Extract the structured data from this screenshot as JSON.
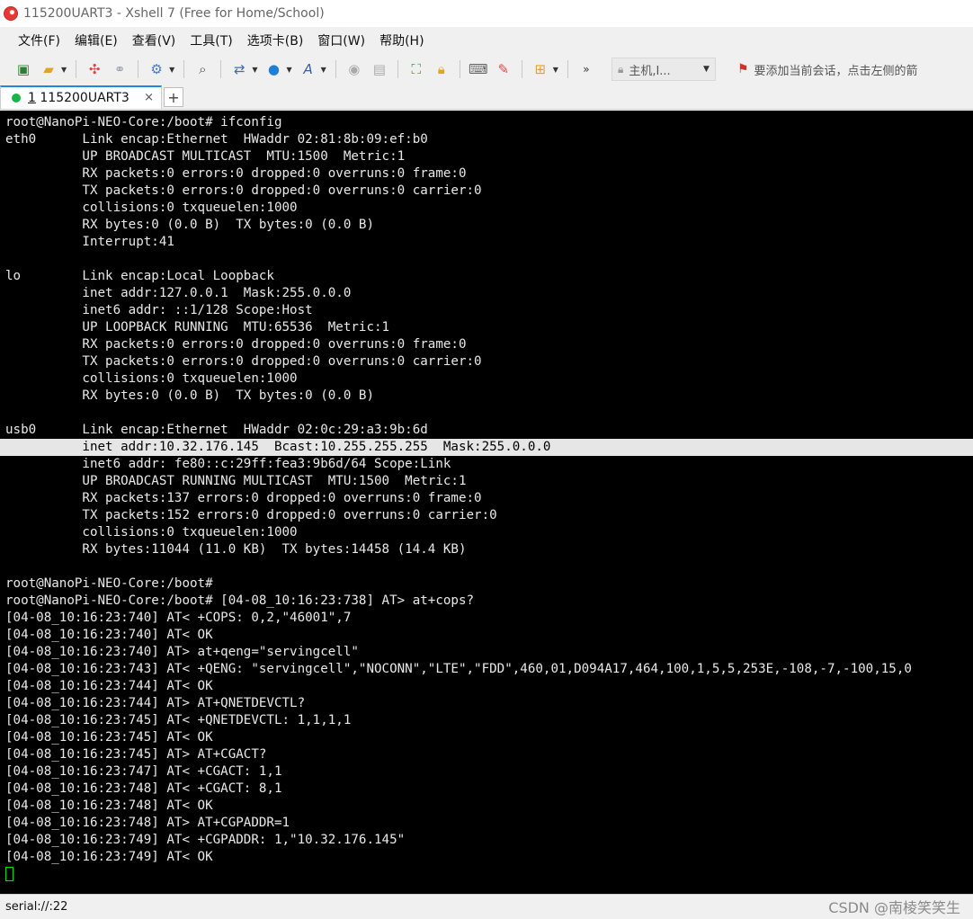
{
  "window": {
    "title": "115200UART3 - Xshell 7 (Free for Home/School)"
  },
  "menu": [
    "文件(F)",
    "编辑(E)",
    "查看(V)",
    "工具(T)",
    "选项卡(B)",
    "窗口(W)",
    "帮助(H)"
  ],
  "toolbar": {
    "host_label": "主机,I...",
    "hint": "要添加当前会话，点击左侧的箭"
  },
  "tab": {
    "number": "1",
    "label": "115200UART3",
    "close": "×",
    "add": "+"
  },
  "terminal": {
    "lines": [
      "root@NanoPi-NEO-Core:/boot# ifconfig",
      "eth0      Link encap:Ethernet  HWaddr 02:81:8b:09:ef:b0",
      "          UP BROADCAST MULTICAST  MTU:1500  Metric:1",
      "          RX packets:0 errors:0 dropped:0 overruns:0 frame:0",
      "          TX packets:0 errors:0 dropped:0 overruns:0 carrier:0",
      "          collisions:0 txqueuelen:1000",
      "          RX bytes:0 (0.0 B)  TX bytes:0 (0.0 B)",
      "          Interrupt:41",
      "",
      "lo        Link encap:Local Loopback",
      "          inet addr:127.0.0.1  Mask:255.0.0.0",
      "          inet6 addr: ::1/128 Scope:Host",
      "          UP LOOPBACK RUNNING  MTU:65536  Metric:1",
      "          RX packets:0 errors:0 dropped:0 overruns:0 frame:0",
      "          TX packets:0 errors:0 dropped:0 overruns:0 carrier:0",
      "          collisions:0 txqueuelen:1000",
      "          RX bytes:0 (0.0 B)  TX bytes:0 (0.0 B)",
      "",
      "usb0      Link encap:Ethernet  HWaddr 02:0c:29:a3:9b:6d",
      "          inet addr:10.32.176.145  Bcast:10.255.255.255  Mask:255.0.0.0",
      "          inet6 addr: fe80::c:29ff:fea3:9b6d/64 Scope:Link",
      "          UP BROADCAST RUNNING MULTICAST  MTU:1500  Metric:1",
      "          RX packets:137 errors:0 dropped:0 overruns:0 frame:0",
      "          TX packets:152 errors:0 dropped:0 overruns:0 carrier:0",
      "          collisions:0 txqueuelen:1000",
      "          RX bytes:11044 (11.0 KB)  TX bytes:14458 (14.4 KB)",
      "",
      "root@NanoPi-NEO-Core:/boot#",
      "root@NanoPi-NEO-Core:/boot# [04-08_10:16:23:738] AT> at+cops?",
      "[04-08_10:16:23:740] AT< +COPS: 0,2,\"46001\",7",
      "[04-08_10:16:23:740] AT< OK",
      "[04-08_10:16:23:740] AT> at+qeng=\"servingcell\"",
      "[04-08_10:16:23:743] AT< +QENG: \"servingcell\",\"NOCONN\",\"LTE\",\"FDD\",460,01,D094A17,464,100,1,5,5,253E,-108,-7,-100,15,0",
      "[04-08_10:16:23:744] AT< OK",
      "[04-08_10:16:23:744] AT> AT+QNETDEVCTL?",
      "[04-08_10:16:23:745] AT< +QNETDEVCTL: 1,1,1,1",
      "[04-08_10:16:23:745] AT< OK",
      "[04-08_10:16:23:745] AT> AT+CGACT?",
      "[04-08_10:16:23:747] AT< +CGACT: 1,1",
      "[04-08_10:16:23:748] AT< +CGACT: 8,1",
      "[04-08_10:16:23:748] AT< OK",
      "[04-08_10:16:23:748] AT> AT+CGPADDR=1",
      "[04-08_10:16:23:749] AT< +CGPADDR: 1,\"10.32.176.145\"",
      "[04-08_10:16:23:749] AT< OK"
    ],
    "selected_line": 19
  },
  "statusbar": {
    "text": "serial://:22"
  },
  "watermark": "CSDN @南棱笑笑生",
  "colors": {
    "terminal_bg": "#000000",
    "terminal_fg": "#e8e8e8",
    "cursor": "#00e000",
    "tab_accent": "#1e88e5",
    "tab_dot": "#19b34a"
  },
  "icons": [
    "new-session-icon",
    "open-folder-icon",
    "connect-icon",
    "disconnect-icon",
    "settings-icon",
    "find-icon",
    "transfer-icon",
    "globe-icon",
    "font-icon",
    "script-icon",
    "screenshot-icon",
    "fullscreen-icon",
    "lock-icon",
    "keyboard-icon",
    "highlight-icon",
    "add-session-icon",
    "more-icon"
  ]
}
